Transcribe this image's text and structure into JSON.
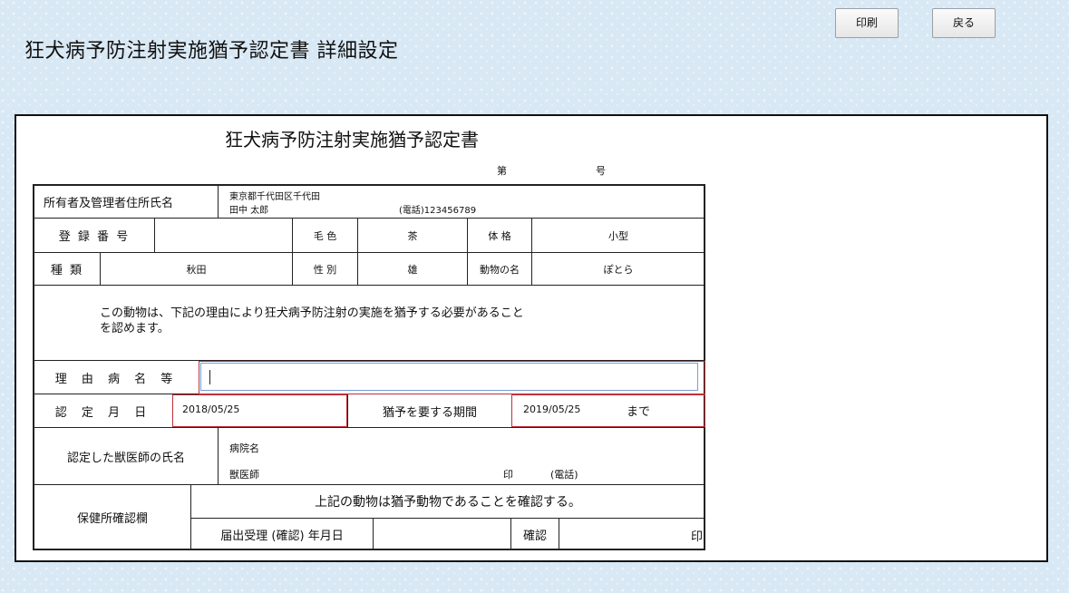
{
  "header": {
    "title": "狂犬病予防注射実施猶予認定書 詳細設定",
    "print_label": "印刷",
    "back_label": "戻る"
  },
  "doc": {
    "title": "狂犬病予防注射実施猶予認定書",
    "number_prefix": "第",
    "number_suffix": "号",
    "owner_label": "所有者及管理者住所氏名",
    "owner_address": "東京都千代田区千代田",
    "owner_name": "田中 太郎",
    "owner_phone": "(電話)123456789",
    "reg_label": "登 録 番 号",
    "reg_value": "",
    "fur_label": "毛 色",
    "fur_value": "茶",
    "build_label": "体 格",
    "build_value": "小型",
    "breed_label": "種 類",
    "breed_value": "秋田",
    "sex_label": "性 別",
    "sex_value": "雄",
    "petname_label": "動物の名",
    "petname_value": "ぽとら",
    "statement_line1": "この動物は、下記の理由により狂犬病予防注射の実施を猶予する必要があること",
    "statement_line2": "を認めます。",
    "reason_label": "理 由 病 名 等",
    "reason_value": "",
    "cert_date_label": "認 定 月 日",
    "cert_date_value": "2018/05/25",
    "period_label": "猶予を要する期間",
    "period_value": "2019/05/25",
    "period_suffix": "まで",
    "vet_label": "認定した獣医師の氏名",
    "hospital_label": "病院名",
    "vet_name_label": "獣医師",
    "seal_label": "印",
    "phone_label": "(電話)",
    "health_label": "保健所確認欄",
    "confirm_text": "上記の動物は猶予動物であることを確認する。",
    "receipt_label": "届出受理 (確認) 年月日",
    "receipt_value": "",
    "check_label": "確認",
    "seal2_label": "印"
  }
}
